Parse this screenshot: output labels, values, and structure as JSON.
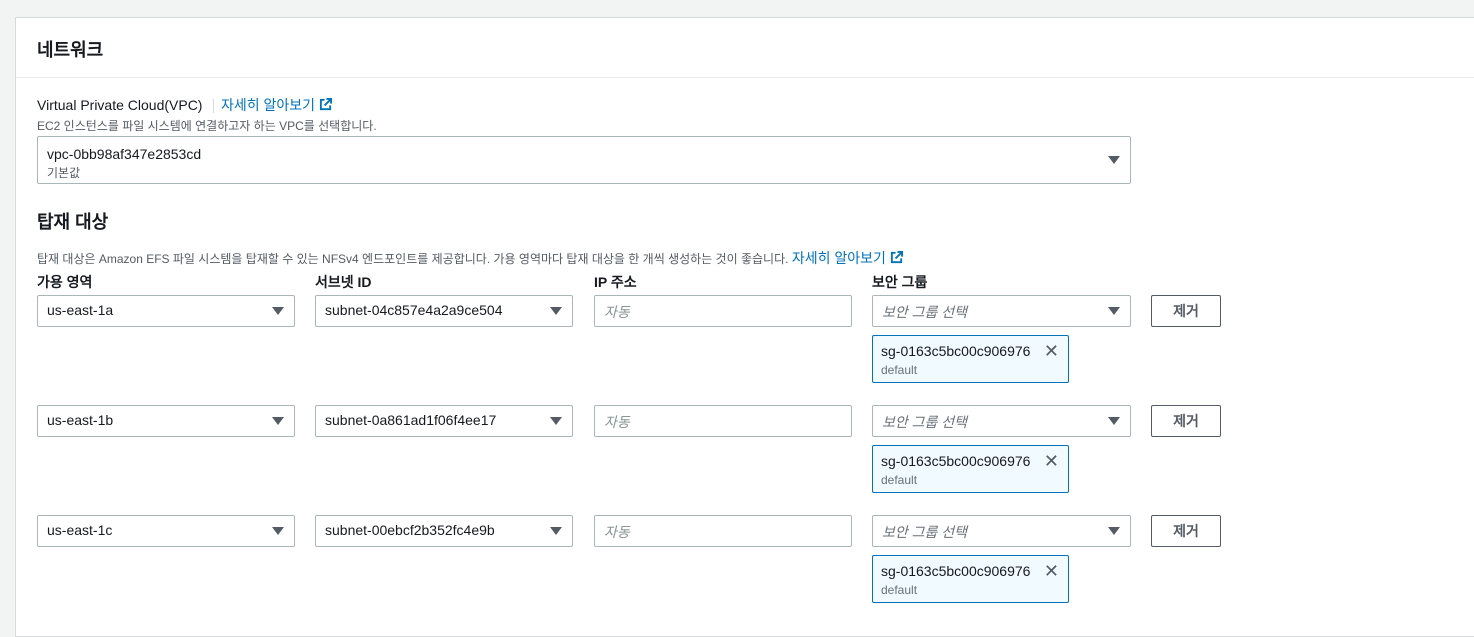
{
  "section": {
    "title": "네트워크"
  },
  "vpc": {
    "label": "Virtual Private Cloud(VPC)",
    "info_link": "자세히 알아보기",
    "description": "EC2 인스턴스를 파일 시스템에 연결하고자 하는 VPC를 선택합니다.",
    "selected_value": "vpc-0bb98af347e2853cd",
    "selected_sub": "기본값"
  },
  "mount_targets": {
    "title": "탑재 대상",
    "description": "탑재 대상은 Amazon EFS 파일 시스템을 탑재할 수 있는 NFSv4 엔드포인트를 제공합니다. 가용 영역마다 탑재 대상을 한 개씩 생성하는 것이 좋습니다.",
    "info_link": "자세히 알아보기",
    "columns": {
      "az": "가용 영역",
      "subnet": "서브넷 ID",
      "ip": "IP 주소",
      "sg": "보안 그룹"
    },
    "rows": [
      {
        "az": "us-east-1a",
        "subnet": "subnet-04c857e4a2a9ce504",
        "ip_placeholder": "자동",
        "sg_placeholder": "보안 그룹 선택",
        "sg_token": "sg-0163c5bc00c906976",
        "sg_token_sub": "default",
        "remove_label": "제거"
      },
      {
        "az": "us-east-1b",
        "subnet": "subnet-0a861ad1f06f4ee17",
        "ip_placeholder": "자동",
        "sg_placeholder": "보안 그룹 선택",
        "sg_token": "sg-0163c5bc00c906976",
        "sg_token_sub": "default",
        "remove_label": "제거"
      },
      {
        "az": "us-east-1c",
        "subnet": "subnet-00ebcf2b352fc4e9b",
        "ip_placeholder": "자동",
        "sg_placeholder": "보안 그룹 선택",
        "sg_token": "sg-0163c5bc00c906976",
        "sg_token_sub": "default",
        "remove_label": "제거"
      }
    ]
  },
  "icons": {
    "external_link": "external-link-icon",
    "dropdown": "caret-down-icon",
    "remove_token": "close-icon"
  },
  "colors": {
    "link": "#0073bb",
    "token_border": "#0073bb",
    "token_bg": "#f1faff",
    "border": "#aab7b8"
  }
}
